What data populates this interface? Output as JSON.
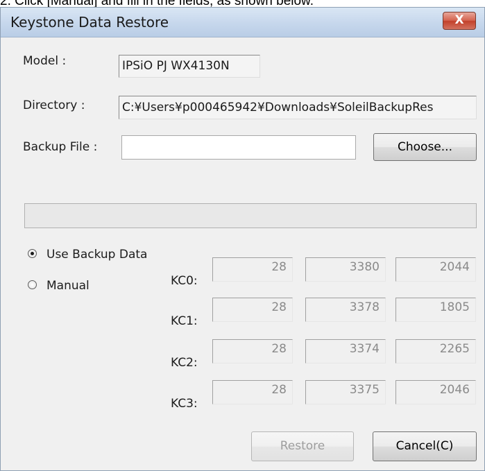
{
  "caption": "2.  Click [Manual] and fill in the fields, as shown below.",
  "window": {
    "title": "Keystone Data Restore",
    "close_label": "X"
  },
  "model": {
    "label": "Model :",
    "value": "IPSiO PJ WX4130N"
  },
  "directory": {
    "label": "Directory :",
    "value": "C:¥Users¥p000465942¥Downloads¥SoleilBackupRes"
  },
  "backup_file": {
    "label": "Backup File :",
    "value": "",
    "choose_label": "Choose..."
  },
  "progress": {
    "fraction": 0.0
  },
  "mode": {
    "use_backup_label": "Use Backup Data",
    "manual_label": "Manual",
    "selected": "use_backup"
  },
  "kc": [
    {
      "label": "KC0:",
      "values": [
        "28",
        "3380",
        "2044"
      ]
    },
    {
      "label": "KC1:",
      "values": [
        "28",
        "3378",
        "1805"
      ]
    },
    {
      "label": "KC2:",
      "values": [
        "28",
        "3374",
        "2265"
      ]
    },
    {
      "label": "KC3:",
      "values": [
        "28",
        "3375",
        "2046"
      ]
    }
  ],
  "buttons": {
    "restore_label": "Restore",
    "cancel_label": "Cancel(C)"
  },
  "colors": {
    "progress_fill": "#06b025",
    "close_button": "#c2412b"
  }
}
